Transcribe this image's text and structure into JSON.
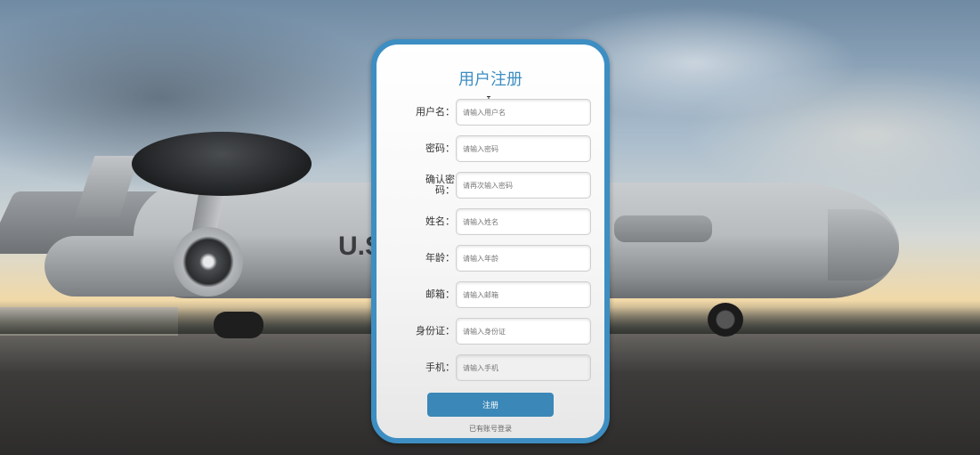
{
  "form": {
    "title": "用户注册",
    "fields": [
      {
        "label": "用户名：",
        "placeholder": "请输入用户名"
      },
      {
        "label": "密码：",
        "placeholder": "请输入密码"
      },
      {
        "label": "确认密码：",
        "placeholder": "请再次输入密码"
      },
      {
        "label": "姓名：",
        "placeholder": "请输入姓名"
      },
      {
        "label": "年龄：",
        "placeholder": "请输入年龄"
      },
      {
        "label": "邮箱：",
        "placeholder": "请输入邮箱"
      },
      {
        "label": "身份证：",
        "placeholder": "请输入身份证"
      },
      {
        "label": "手机：",
        "placeholder": "请输入手机"
      }
    ],
    "submit_label": "注册",
    "login_link": "已有账号登录"
  },
  "background": {
    "fuselage_marking": "U.S"
  },
  "colors": {
    "accent": "#3d8ec2",
    "button": "#3a87b8"
  }
}
